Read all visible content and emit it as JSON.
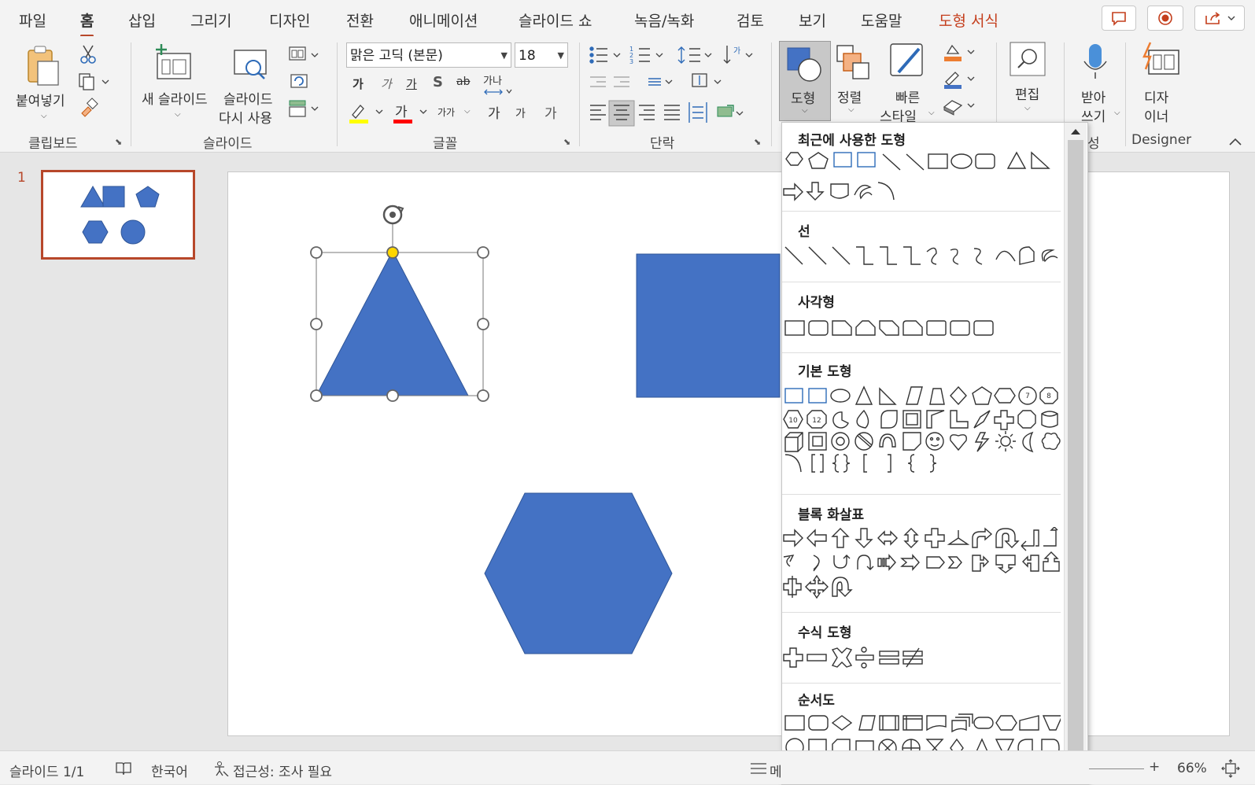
{
  "tabs": [
    {
      "label": "파일"
    },
    {
      "label": "홈"
    },
    {
      "label": "삽입"
    },
    {
      "label": "그리기"
    },
    {
      "label": "디자인"
    },
    {
      "label": "전환"
    },
    {
      "label": "애니메이션"
    },
    {
      "label": "슬라이드 쇼"
    },
    {
      "label": "녹음/녹화"
    },
    {
      "label": "검토"
    },
    {
      "label": "보기"
    },
    {
      "label": "도움말"
    },
    {
      "label": "도형 서식"
    }
  ],
  "ribbon": {
    "clipboard": {
      "group": "클립보드",
      "paste": "붙여넣기"
    },
    "slides": {
      "group": "슬라이드",
      "new_slide": "새 슬라이드",
      "reuse_line1": "슬라이드",
      "reuse_line2": "다시 사용"
    },
    "font": {
      "group": "글꼴",
      "font_name": "맑은 고딕 (본문)",
      "font_size": "18",
      "bold": "가",
      "italic": "가",
      "underline": "가",
      "shadow": "S",
      "strike": "ab",
      "spacing": "가나",
      "font_color": "가",
      "case": "가가",
      "grow": "가",
      "shrink": "가",
      "clear": "가"
    },
    "paragraph": {
      "group": "단락"
    },
    "drawing": {
      "shapes": "도형",
      "arrange": "정렬",
      "quick_styles_line1": "빠른",
      "quick_styles_line2": "스타일"
    },
    "editing": {
      "label": "편집"
    },
    "voice": {
      "line1": "받아",
      "line2": "쓰기",
      "group_partial": "성"
    },
    "designer": {
      "line1": "디자",
      "line2": "이너",
      "group": "Designer"
    }
  },
  "thumbnail": {
    "slide_number": "1"
  },
  "gallery": {
    "sections": [
      {
        "title": "최근에 사용한 도형"
      },
      {
        "title": "선"
      },
      {
        "title": "사각형"
      },
      {
        "title": "기본 도형"
      },
      {
        "title": "블록 화살표"
      },
      {
        "title": "수식 도형"
      },
      {
        "title": "순서도"
      }
    ],
    "badges": {
      "seven": "7",
      "eight": "8",
      "ten": "10",
      "twelve": "12"
    }
  },
  "status": {
    "slide_count": "슬라이드 1/1",
    "language": "한국어",
    "accessibility": "접근성: 조사 필요",
    "notes_partial": "메",
    "zoom": "66%"
  },
  "colors": {
    "accent": "#b7472a",
    "shape_fill": "#4472c4",
    "shape_stroke": "#2f5597",
    "contextual_tab": "#c43e1c",
    "selection_handle_yellow": "#ffd700"
  }
}
